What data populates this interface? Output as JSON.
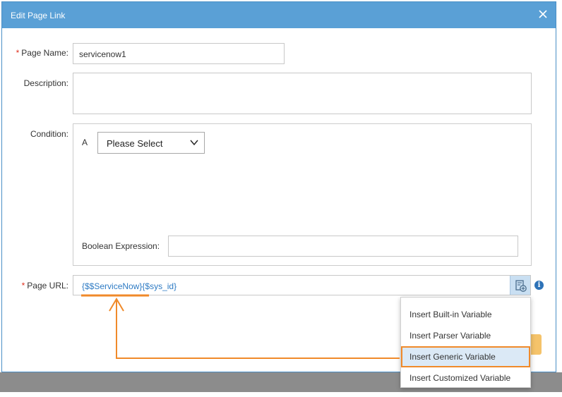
{
  "dialog": {
    "title": "Edit Page Link",
    "close_icon": "close-icon"
  },
  "form": {
    "page_name": {
      "label": "Page Name:",
      "required": "*",
      "value": "servicenow1"
    },
    "description": {
      "label": "Description:",
      "value": ""
    },
    "condition": {
      "label": "Condition:",
      "row_letter": "A",
      "select_value": "Please Select",
      "boolean_label": "Boolean Expression:",
      "boolean_value": ""
    },
    "page_url": {
      "label": "Page URL:",
      "required": "*",
      "value": "{$$ServiceNow}{$sys_id}",
      "insert_icon": "insert-variable-icon",
      "info_icon": "info-icon",
      "info_glyph": "i"
    }
  },
  "variable_menu": {
    "items": [
      "Insert Built-in Variable",
      "Insert Parser Variable",
      "Insert Generic Variable",
      "Insert Customized Variable"
    ],
    "highlighted_index": 2
  },
  "colors": {
    "titlebar": "#5aa0d6",
    "url_text": "#2e7bc4",
    "required": "#e0301e",
    "annotation": "#f08a2a",
    "menu_highlight": "#dbe9f6"
  }
}
